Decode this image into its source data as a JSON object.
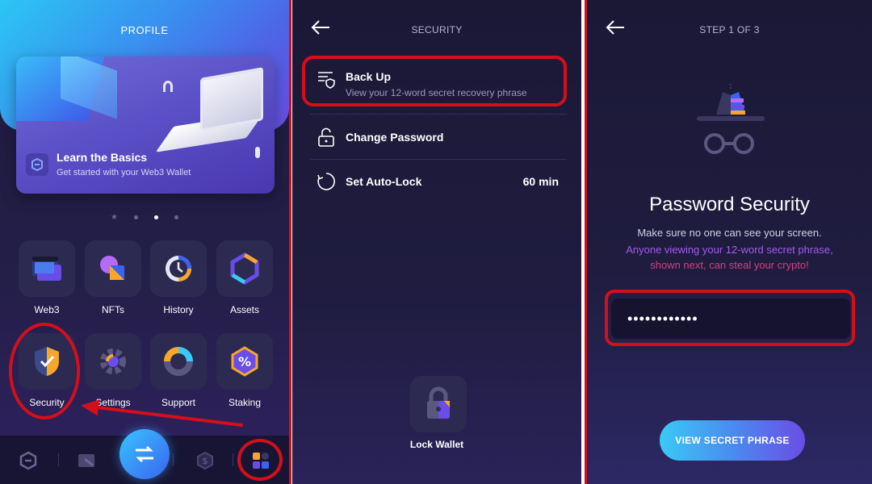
{
  "profile": {
    "title": "PROFILE",
    "card": {
      "title": "Learn the Basics",
      "subtitle": "Get started with your Web3 Wallet"
    },
    "tiles": [
      {
        "label": "Web3",
        "icon": "browser-window-icon"
      },
      {
        "label": "NFTs",
        "icon": "nft-shapes-icon"
      },
      {
        "label": "History",
        "icon": "clock-icon"
      },
      {
        "label": "Assets",
        "icon": "hexagon-assets-icon"
      },
      {
        "label": "Security",
        "icon": "shield-check-icon"
      },
      {
        "label": "Settings",
        "icon": "gear-icon"
      },
      {
        "label": "Support",
        "icon": "lifebuoy-icon"
      },
      {
        "label": "Staking",
        "icon": "percent-hexagon-icon"
      }
    ],
    "bottom_nav": [
      "logo-icon",
      "wallet-icon",
      "swap-icon",
      "dollar-hexagon-icon",
      "apps-grid-icon"
    ]
  },
  "security": {
    "header": "SECURITY",
    "items": [
      {
        "title": "Back Up",
        "subtitle": "View your 12-word secret recovery phrase",
        "icon": "list-shield-icon"
      },
      {
        "title": "Change Password",
        "icon": "unlock-icon"
      },
      {
        "title": "Set Auto-Lock",
        "value": "60 min",
        "icon": "timer-icon"
      }
    ],
    "lock_wallet": "Lock Wallet"
  },
  "password": {
    "step": "STEP 1 OF 3",
    "title": "Password Security",
    "line1": "Make sure no one can see your screen.",
    "line2": "Anyone viewing your 12-word secret phrase,",
    "line3": "shown next, can steal your crypto!",
    "input_value": "••••••••••••",
    "button": "VIEW SECRET PHRASE"
  },
  "colors": {
    "highlight": "#d40f1a",
    "accent_blue": "#3ac9f5",
    "accent_purple": "#6b4de6"
  }
}
